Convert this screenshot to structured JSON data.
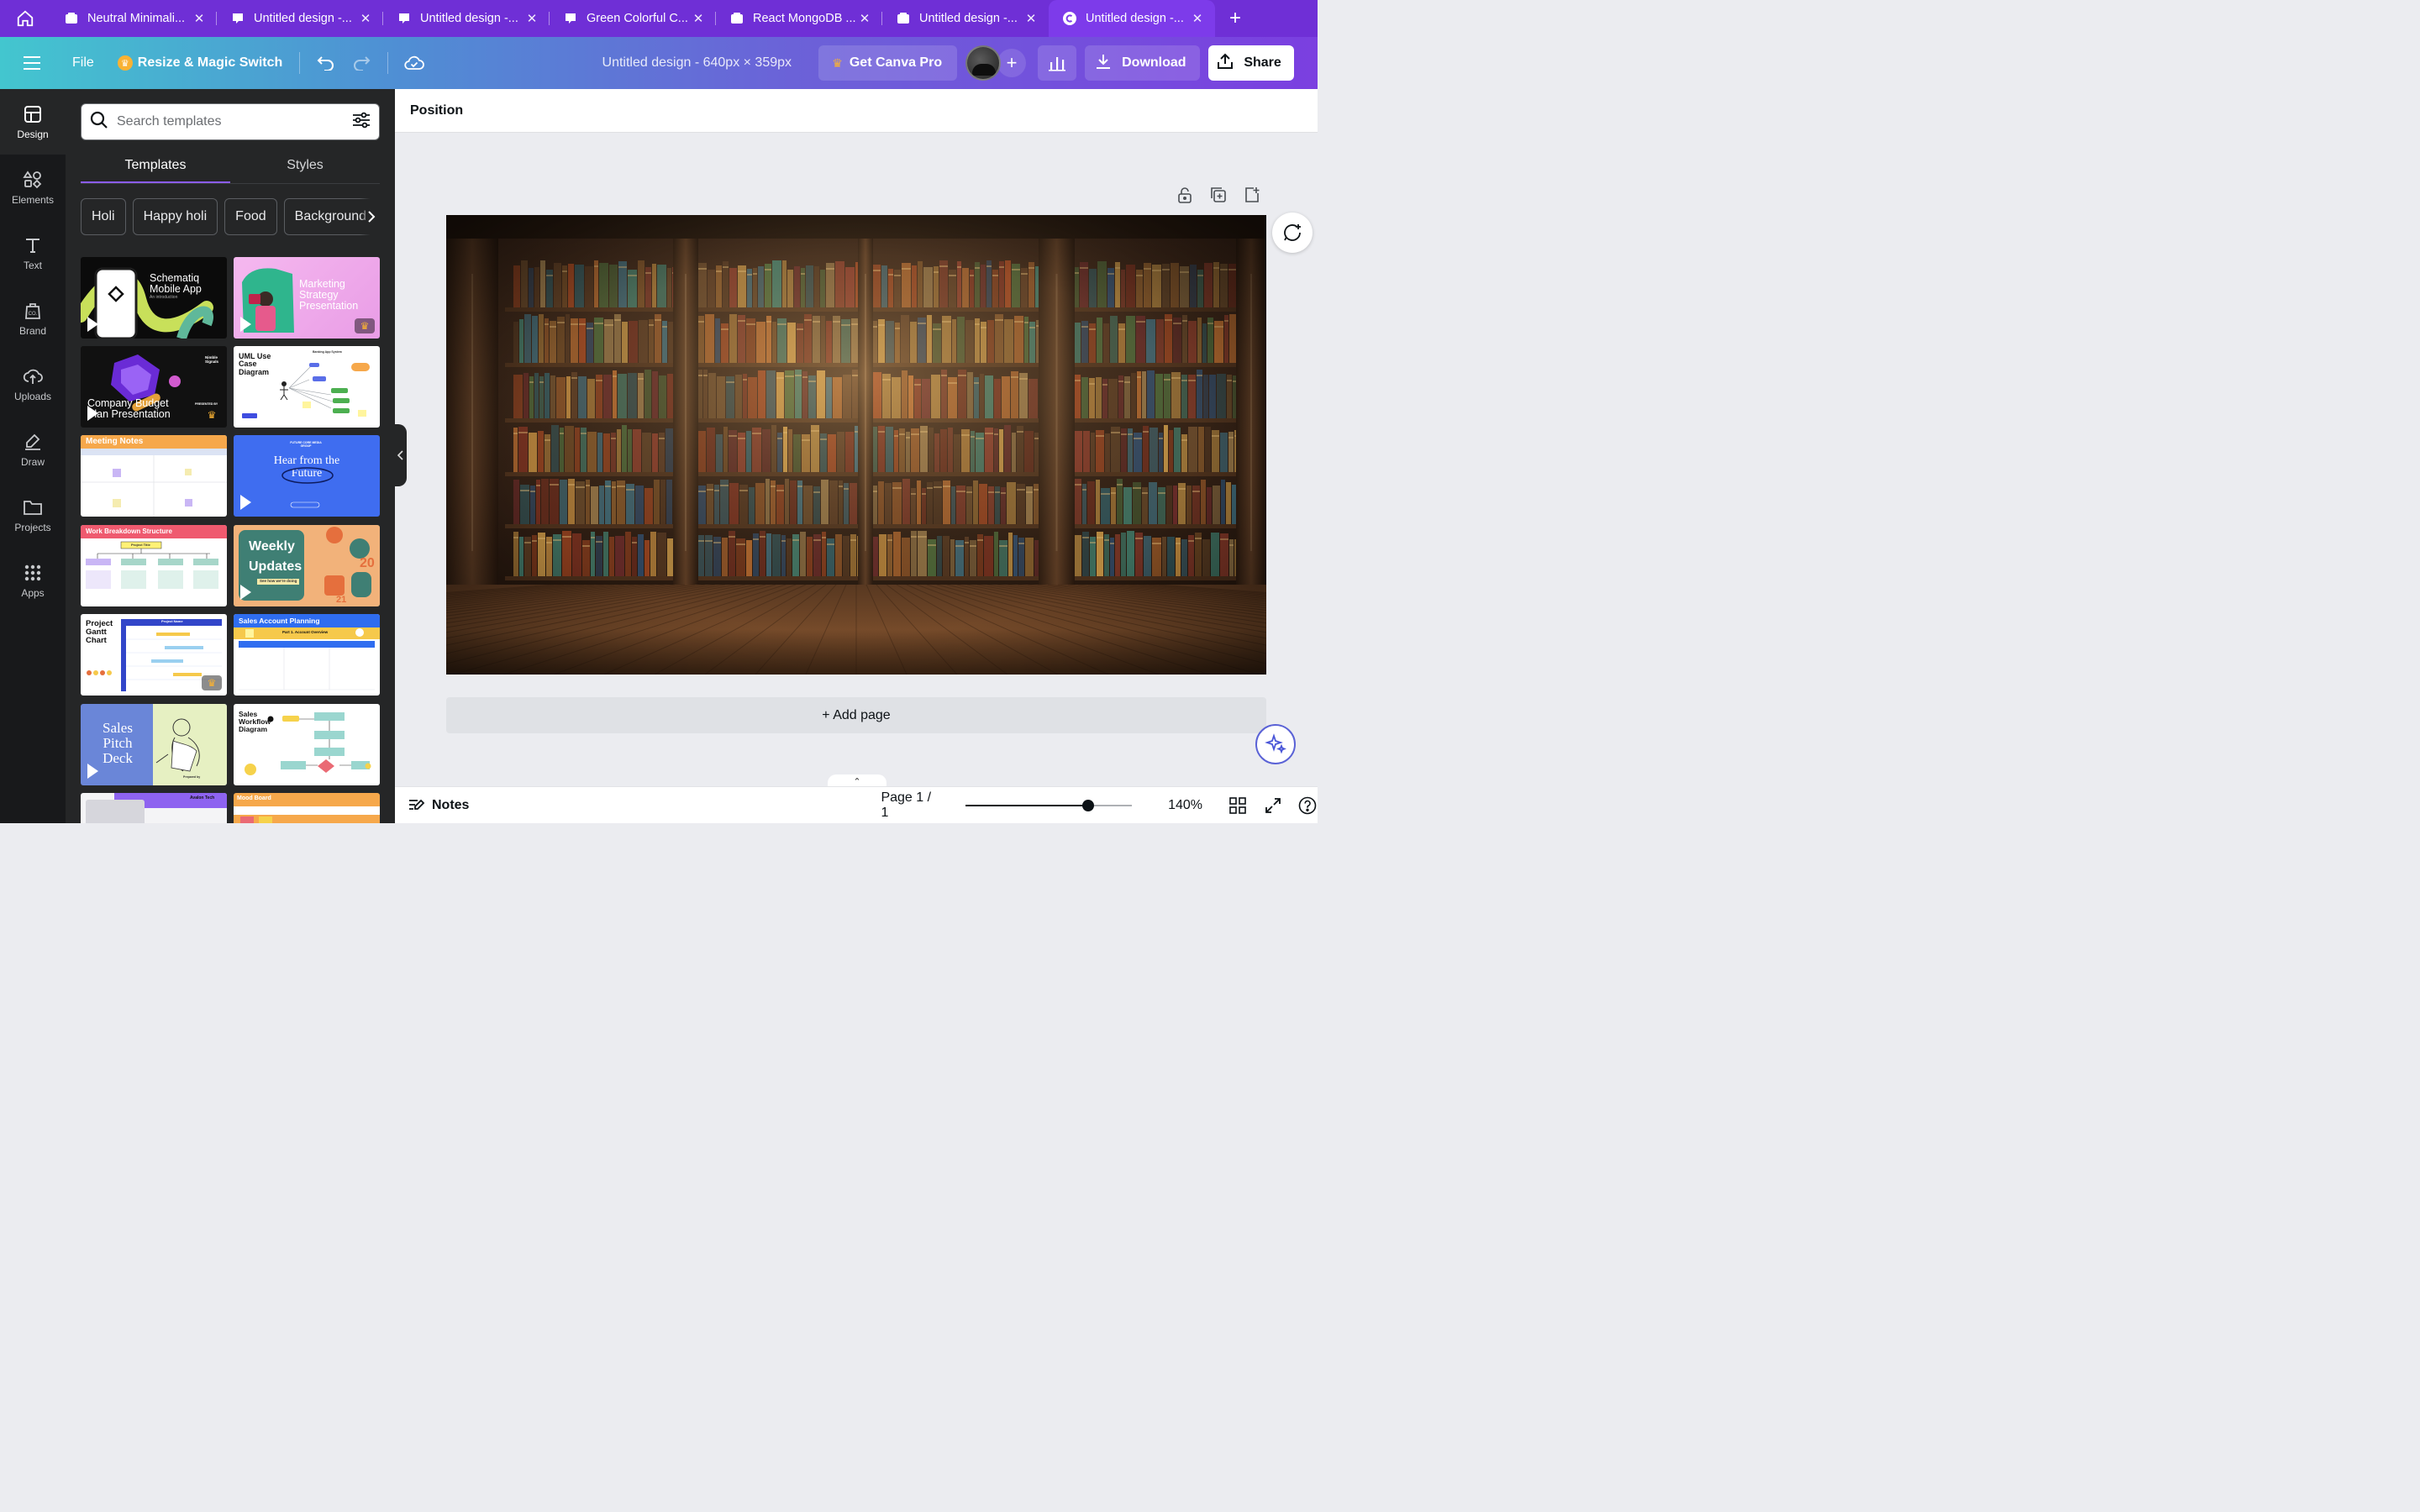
{
  "browser": {
    "tabs": [
      {
        "title": "Neutral Minimali...",
        "icon": "doc-icon",
        "active": false
      },
      {
        "title": "Untitled design -...",
        "icon": "canva-icon",
        "active": false
      },
      {
        "title": "Untitled design -...",
        "icon": "canva-icon",
        "active": false
      },
      {
        "title": "Green Colorful C...",
        "icon": "canva-icon",
        "active": false
      },
      {
        "title": "React MongoDB ...",
        "icon": "doc-icon",
        "active": false
      },
      {
        "title": "Untitled design -...",
        "icon": "doc-icon",
        "active": false
      },
      {
        "title": "Untitled design -...",
        "icon": "canva-c-icon",
        "active": true
      }
    ]
  },
  "toolbar": {
    "file_label": "File",
    "resize_label": "Resize & Magic Switch",
    "doc_title": "Untitled design - 640px × 359px",
    "pro_label": "Get Canva Pro",
    "download_label": "Download",
    "share_label": "Share"
  },
  "rail": [
    {
      "label": "Design",
      "icon": "design-icon",
      "active": true
    },
    {
      "label": "Elements",
      "icon": "elements-icon"
    },
    {
      "label": "Text",
      "icon": "text-icon"
    },
    {
      "label": "Brand",
      "icon": "brand-icon"
    },
    {
      "label": "Uploads",
      "icon": "uploads-icon"
    },
    {
      "label": "Draw",
      "icon": "draw-icon"
    },
    {
      "label": "Projects",
      "icon": "projects-icon"
    },
    {
      "label": "Apps",
      "icon": "apps-icon"
    }
  ],
  "panel": {
    "search_placeholder": "Search templates",
    "tabs": [
      "Templates",
      "Styles"
    ],
    "chips": [
      "Holi",
      "Happy holi",
      "Food",
      "Background"
    ],
    "templates": [
      {
        "title": "Schematiq Mobile App",
        "sub": "An introduction"
      },
      {
        "title": "Marketing Strategy Presentation"
      },
      {
        "title": "Company Budget Plan Presentation",
        "brand": "Nimble Signals",
        "tag": "PRESENTED BY"
      },
      {
        "title": "UML Use Case Diagram",
        "sub": "Banking App System"
      },
      {
        "title": "Meeting Notes"
      },
      {
        "title": "Hear from the Future",
        "brand": "FUTURE CORE MEDIA GROUP"
      },
      {
        "title": "Work Breakdown Structure",
        "sub": "Project Title"
      },
      {
        "title": "Weekly Updates",
        "sub": "See how we're doing"
      },
      {
        "title": "Project Gantt Chart",
        "sub": "Project Name"
      },
      {
        "title": "Sales Account Planning",
        "sub": "Part 1. Account Overview"
      },
      {
        "title": "Sales Pitch Deck",
        "sub": "Prepared by"
      },
      {
        "title": "Sales Workflow Diagram"
      },
      {
        "title": "",
        "brand": "Avalon Tech"
      },
      {
        "title": "Mood Board"
      }
    ]
  },
  "context_bar": {
    "position_label": "Position"
  },
  "canvas": {
    "add_page_label": "+ Add page"
  },
  "bottom_bar": {
    "notes_label": "Notes",
    "page_count": "Page 1 / 1",
    "zoom_label": "140%",
    "zoom_level": 0.67
  },
  "colors": {
    "tab_strip": "#6f2fd6",
    "toolbar_start": "#43c6cf",
    "toolbar_end": "#7b3fe0",
    "panel_bg": "#252627",
    "rail_bg": "#18191b",
    "accent": "#8b5cf6",
    "crown": "#f9b233"
  }
}
